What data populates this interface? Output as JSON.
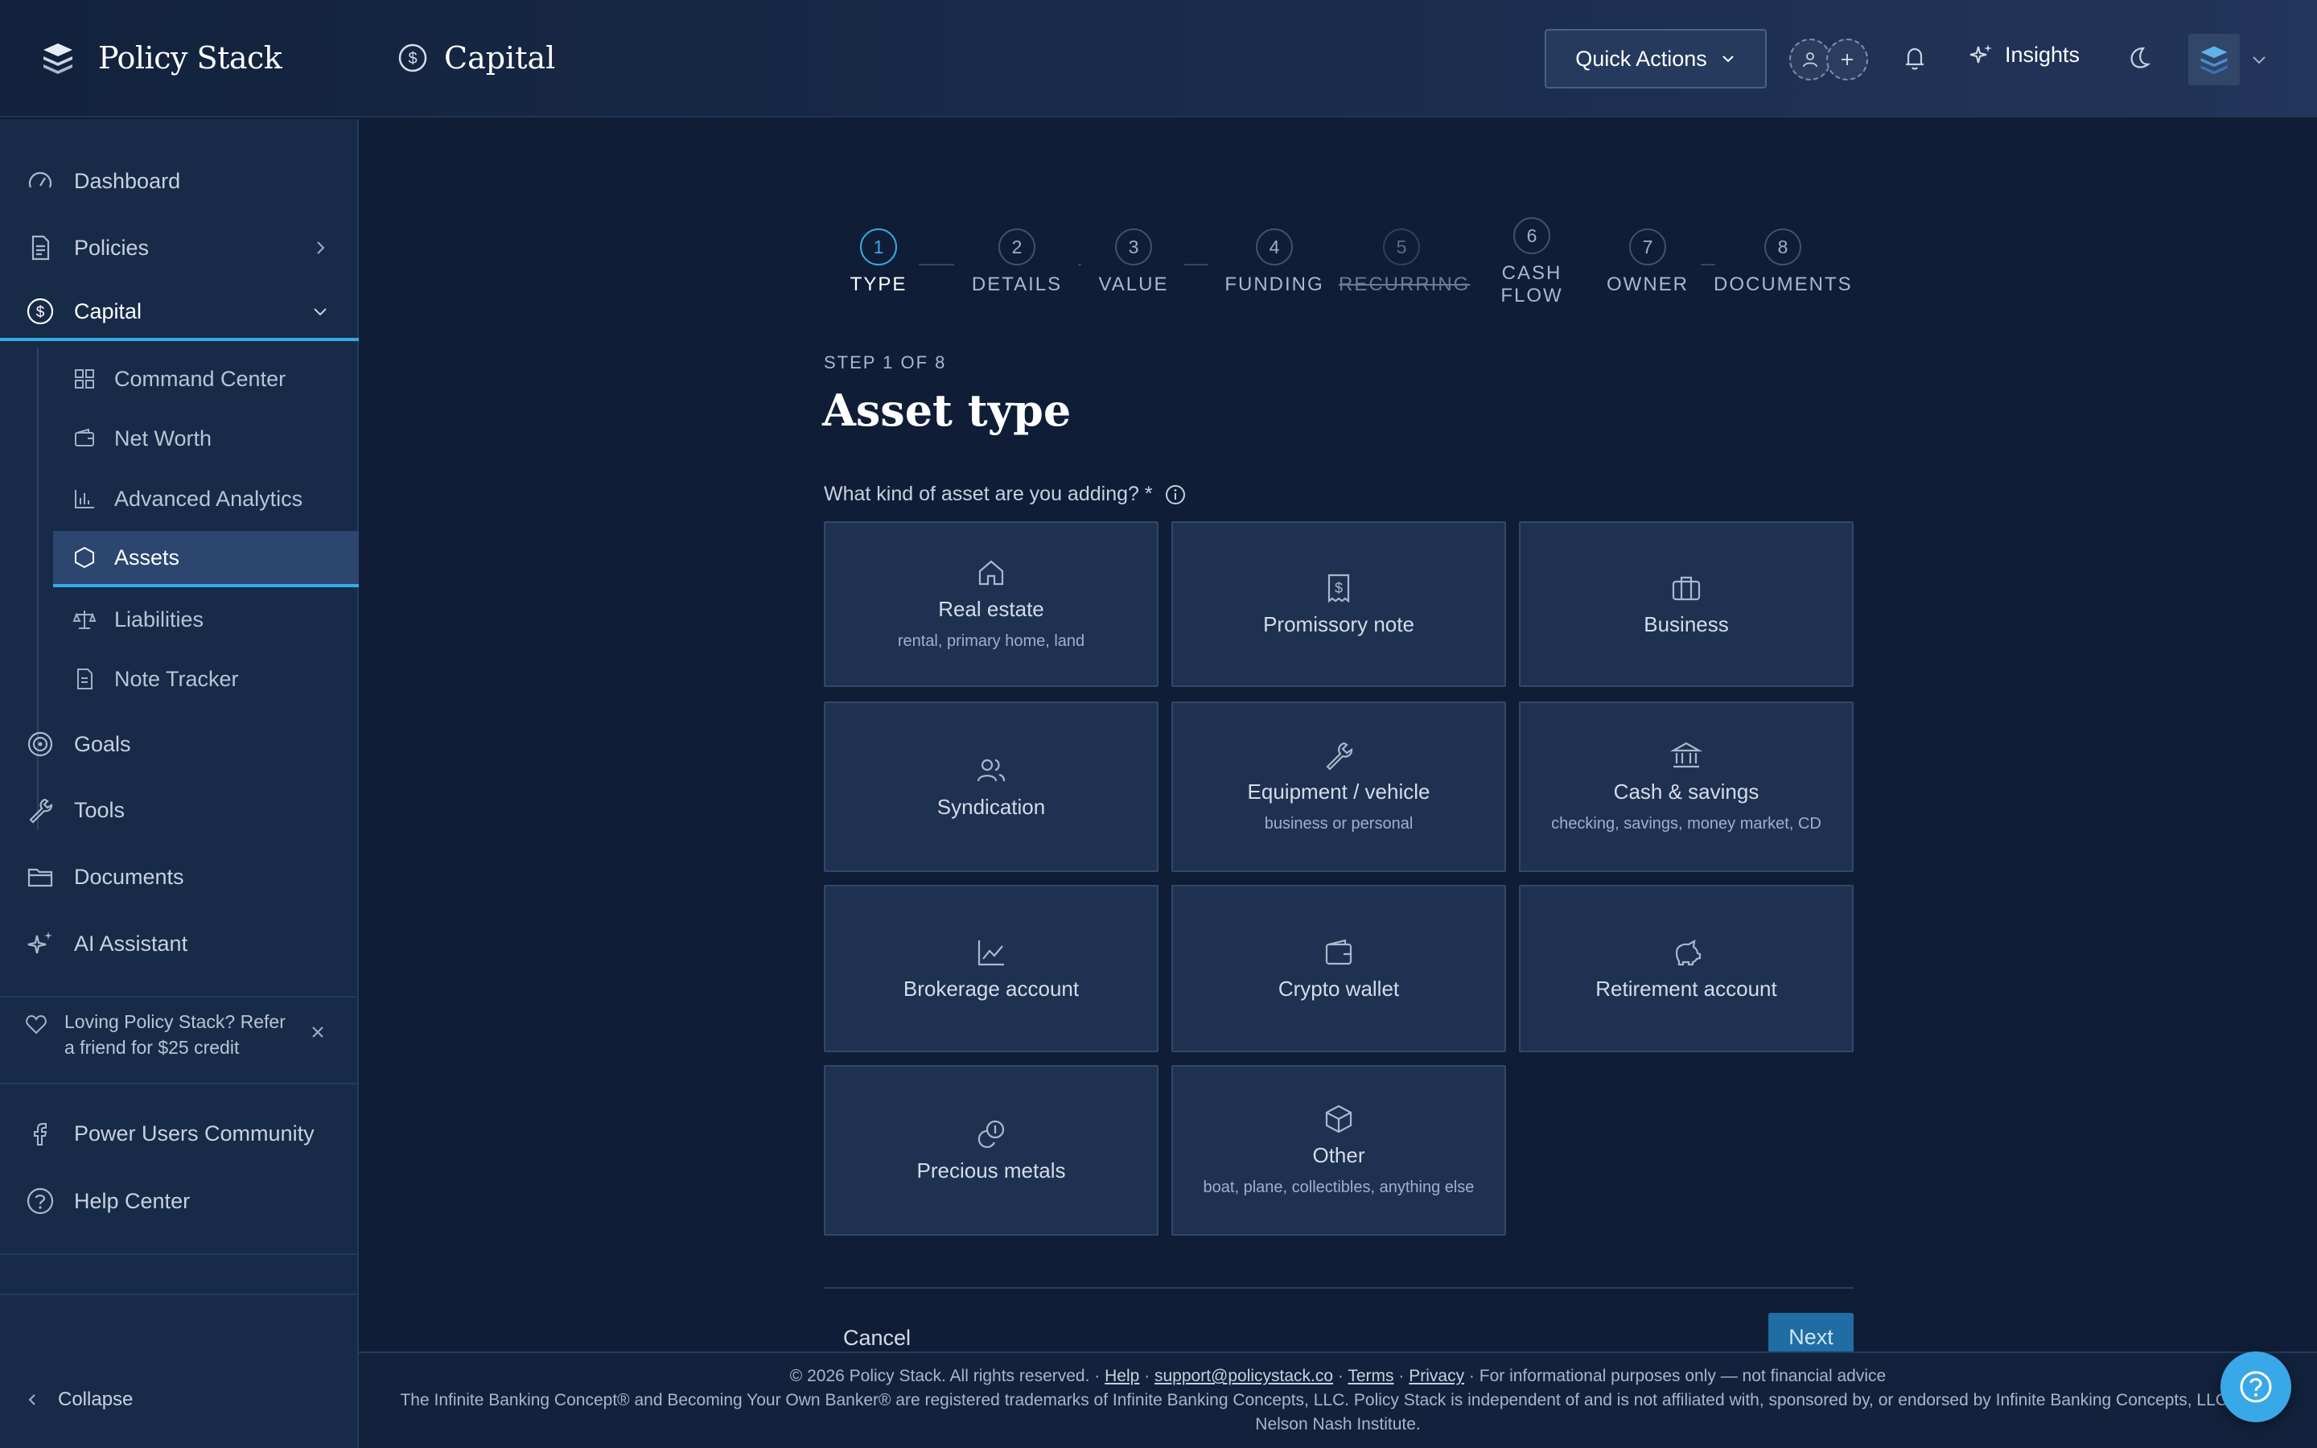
{
  "app": {
    "name": "Policy Stack",
    "section_title": "Capital"
  },
  "header": {
    "quick_actions_label": "Quick Actions",
    "insights_label": "Insights",
    "icons": [
      "brand-logo-icon",
      "dollar-circle-icon",
      "chevron-down-icon",
      "user-icon",
      "plus-icon",
      "bell-icon",
      "sparkle-icon",
      "moon-icon",
      "avatar"
    ]
  },
  "sidebar": {
    "items": {
      "dashboard": "Dashboard",
      "policies": "Policies",
      "capital": "Capital",
      "goals": "Goals",
      "tools": "Tools",
      "documents": "Documents",
      "ai_assistant": "AI Assistant",
      "community": "Power Users Community",
      "help_center": "Help Center"
    },
    "sub_items": {
      "command_center": "Command Center",
      "net_worth": "Net Worth",
      "advanced_analytics": "Advanced Analytics",
      "assets": "Assets",
      "liabilities": "Liabilities",
      "note_tracker": "Note Tracker"
    },
    "refer_text": "Loving Policy Stack? Refer a friend for $25 credit",
    "collapse_label": "Collapse"
  },
  "stepper": {
    "steps": [
      {
        "num": "1",
        "name": "TYPE",
        "state": "active"
      },
      {
        "num": "2",
        "name": "DETAILS",
        "state": "todo"
      },
      {
        "num": "3",
        "name": "VALUE",
        "state": "todo"
      },
      {
        "num": "4",
        "name": "FUNDING",
        "state": "todo"
      },
      {
        "num": "5",
        "name": "RECURRING",
        "state": "skipped"
      },
      {
        "num": "6",
        "name": "CASH FLOW",
        "state": "todo"
      },
      {
        "num": "7",
        "name": "OWNER",
        "state": "todo"
      },
      {
        "num": "8",
        "name": "DOCUMENTS",
        "state": "todo"
      }
    ]
  },
  "form": {
    "step_of": "STEP 1 OF 8",
    "heading": "Asset type",
    "question": "What kind of asset are you adding? *",
    "options": [
      {
        "title": "Real estate",
        "sub": "rental, primary home, land",
        "icon": "home-icon"
      },
      {
        "title": "Promissory note",
        "sub": "",
        "icon": "receipt-dollar-icon"
      },
      {
        "title": "Business",
        "sub": "",
        "icon": "briefcase-icon"
      },
      {
        "title": "Syndication",
        "sub": "",
        "icon": "users-icon"
      },
      {
        "title": "Equipment / vehicle",
        "sub": "business or personal",
        "icon": "wrench-icon"
      },
      {
        "title": "Cash & savings",
        "sub": "checking, savings, money market, CD",
        "icon": "bank-icon"
      },
      {
        "title": "Brokerage account",
        "sub": "",
        "icon": "line-chart-icon"
      },
      {
        "title": "Crypto wallet",
        "sub": "",
        "icon": "wallet-icon"
      },
      {
        "title": "Retirement account",
        "sub": "",
        "icon": "piggy-bank-icon"
      },
      {
        "title": "Precious metals",
        "sub": "",
        "icon": "coins-icon"
      },
      {
        "title": "Other",
        "sub": "boat, plane, collectibles, anything else",
        "icon": "box-icon"
      }
    ],
    "cancel_label": "Cancel",
    "next_label": "Next"
  },
  "footer": {
    "copyright": "© 2026 Policy Stack. All rights reserved. ·",
    "help": "Help",
    "email": "support@policystack.co",
    "terms": "Terms",
    "privacy": "Privacy",
    "disclaimer": "· For informational purposes only — not financial advice",
    "trademark": "The Infinite Banking Concept® and Becoming Your Own Banker® are registered trademarks of Infinite Banking Concepts, LLC. Policy Stack is independent of and is not affiliated with, sponsored by, or endorsed by Infinite Banking Concepts, LLC or the Nelson Nash Institute."
  },
  "colors": {
    "accent": "#36a9e6",
    "background": "#0f1e36",
    "sidebar": "#172a47",
    "card": "#1e3150"
  }
}
